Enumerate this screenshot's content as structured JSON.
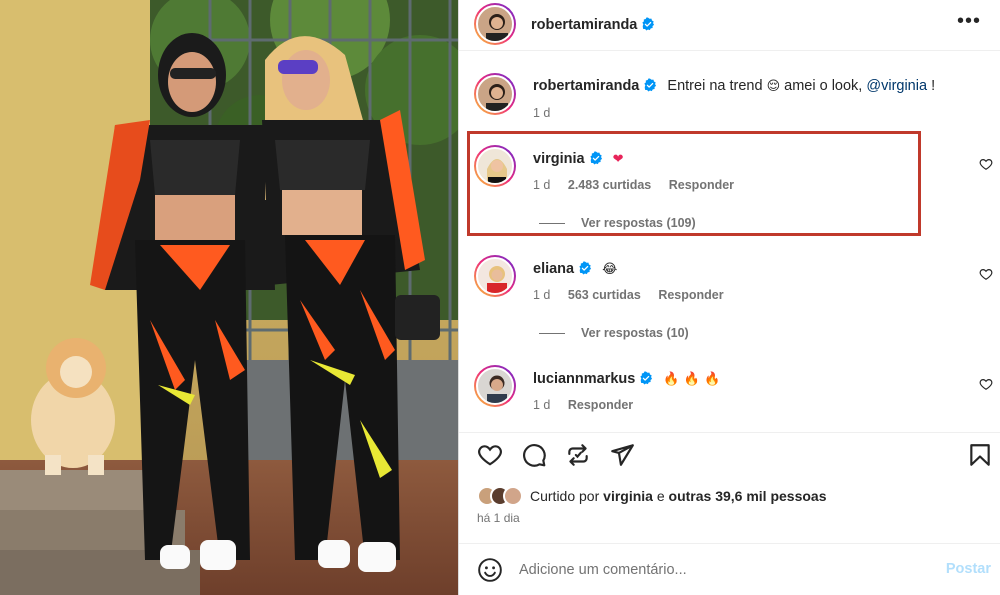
{
  "post": {
    "author": "robertamiranda",
    "more_icon": "more-horizontal-icon"
  },
  "caption": {
    "author": "robertamiranda",
    "text_before": "Entrei na trend",
    "emoji": "😌",
    "text_after": "amei o look,",
    "mention": "@virginia",
    "text_end": "!",
    "time": "1 d"
  },
  "comments": [
    {
      "user": "virginia",
      "emoji": "❤",
      "time": "1 d",
      "likes": "2.483 curtidas",
      "reply_label": "Responder",
      "view_replies": "Ver respostas (109)"
    },
    {
      "user": "eliana",
      "emoji": "😂",
      "time": "1 d",
      "likes": "563 curtidas",
      "reply_label": "Responder",
      "view_replies": "Ver respostas (10)"
    },
    {
      "user": "luciannmarkus",
      "emoji": "🔥 🔥 🔥",
      "time": "1 d",
      "reply_label": "Responder"
    }
  ],
  "likes": {
    "prefix": "Curtido por",
    "user": "virginia",
    "connector": "e",
    "others": "outras 39,6 mil pessoas"
  },
  "time_ago": "há 1 dia",
  "add_comment": {
    "placeholder": "Adicione um comentário...",
    "post_label": "Postar"
  },
  "colors": {
    "verified": "#0095f6",
    "highlight": "#c0392b",
    "post_button": "#b2dffc"
  }
}
